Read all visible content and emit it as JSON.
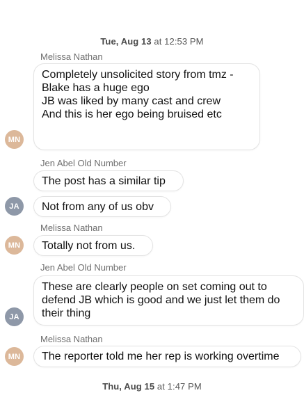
{
  "timestamps": {
    "first": {
      "day": "Tue, Aug 13",
      "rest": " at 12:53 PM"
    },
    "second": {
      "day": "Thu, Aug 15",
      "rest": " at 1:47 PM"
    }
  },
  "messages": [
    {
      "sender": "Melissa Nathan",
      "avatar": "MN",
      "lines": [
        "Completely unsolicited story from tmz -",
        "Blake has a huge ego",
        "JB was liked by many cast and crew",
        "And this is her ego being bruised etc"
      ]
    },
    {
      "sender": "Jen Abel Old Number",
      "avatar": "JA",
      "lines": [
        "The post has a similar tip"
      ]
    },
    {
      "sender": "",
      "avatar": "JA",
      "lines": [
        "Not from any of us obv"
      ]
    },
    {
      "sender": "Melissa Nathan",
      "avatar": "MN",
      "lines": [
        "Totally not from us."
      ]
    },
    {
      "sender": "Jen Abel Old Number",
      "avatar": "JA",
      "lines": [
        "These are clearly people on set coming out to",
        "defend JB which is good and we just let them do",
        "their thing"
      ]
    },
    {
      "sender": "Melissa Nathan",
      "avatar": "MN",
      "lines": [
        "The reporter told me her rep is working overtime"
      ]
    }
  ],
  "colors": {
    "avatar_mn": "#dcb89a",
    "avatar_ja": "#8e98a8",
    "bubble_border": "#e3e3e3",
    "sender_text": "#6e6e6e"
  }
}
